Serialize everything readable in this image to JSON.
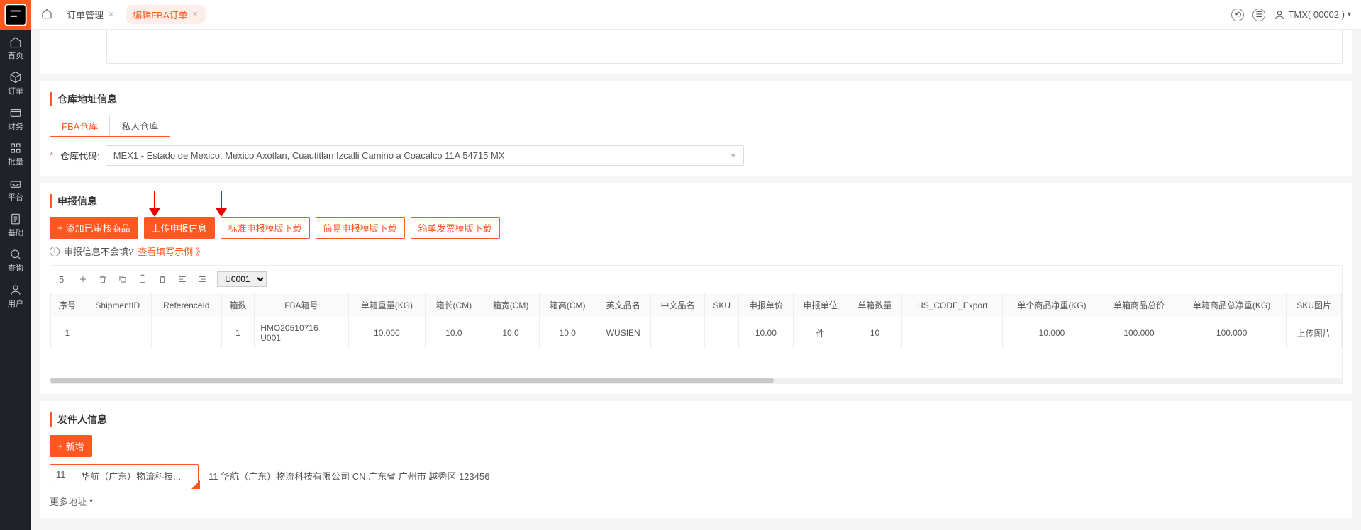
{
  "sidebar": {
    "items": [
      {
        "label": "首页"
      },
      {
        "label": "订单"
      },
      {
        "label": "财务"
      },
      {
        "label": "批量"
      },
      {
        "label": "平台"
      },
      {
        "label": "基础"
      },
      {
        "label": "查询"
      },
      {
        "label": "用户"
      }
    ]
  },
  "header": {
    "tabs": [
      {
        "label": "订单管理",
        "active": false
      },
      {
        "label": "编辑FBA订单",
        "active": true
      }
    ],
    "user": "TMX( 00002 )"
  },
  "warehouse": {
    "title": "仓库地址信息",
    "tab_fba": "FBA仓库",
    "tab_private": "私人仓库",
    "code_label": "仓库代码:",
    "code_value": "MEX1 - Estado de Mexico, Mexico Axotlan, Cuautitlan Izcalli Camino a Coacalco 11A 54715 MX"
  },
  "declaration": {
    "title": "申报信息",
    "btn_add_reviewed": "添加已审核商品",
    "btn_upload": "上传申报信息",
    "btn_std_tpl": "标准申报模版下载",
    "btn_simple_tpl": "简易申报模版下载",
    "btn_box_tpl": "箱单发票模版下载",
    "hint_q": "申报信息不会填?",
    "hint_link": "查看填写示例 》",
    "toolbar_count": "5",
    "toolbar_select": "U0001",
    "columns": [
      "序号",
      "ShipmentID",
      "ReferenceId",
      "箱数",
      "FBA箱号",
      "单箱重量(KG)",
      "箱长(CM)",
      "箱宽(CM)",
      "箱高(CM)",
      "英文品名",
      "中文品名",
      "SKU",
      "申报单价",
      "申报单位",
      "单箱数量",
      "HS_CODE_Export",
      "单个商品净重(KG)",
      "单箱商品总价",
      "单箱商品总净重(KG)",
      "SKU图片"
    ],
    "row": {
      "seq": "1",
      "shipment": "",
      "ref": "",
      "boxes": "1",
      "fba_box": "HMO20510716U001",
      "weight": "10.000",
      "len": "10.0",
      "wid": "10.0",
      "hei": "10.0",
      "en_name": "WUSIEN",
      "cn_name": "",
      "sku": "",
      "price": "10.00",
      "unit": "件",
      "qty": "10",
      "hs": "",
      "net_each": "10.000",
      "total_price": "100.000",
      "total_net": "100.000",
      "img": "上传图片"
    }
  },
  "sender": {
    "title": "发件人信息",
    "btn_new": "新增",
    "sel_code": "11",
    "sel_name": "华航（广东）物流科技...",
    "full": "11 华航（广东）物流科技有限公司 CN 广东省 广州市 越秀区 123456",
    "more": "更多地址"
  }
}
